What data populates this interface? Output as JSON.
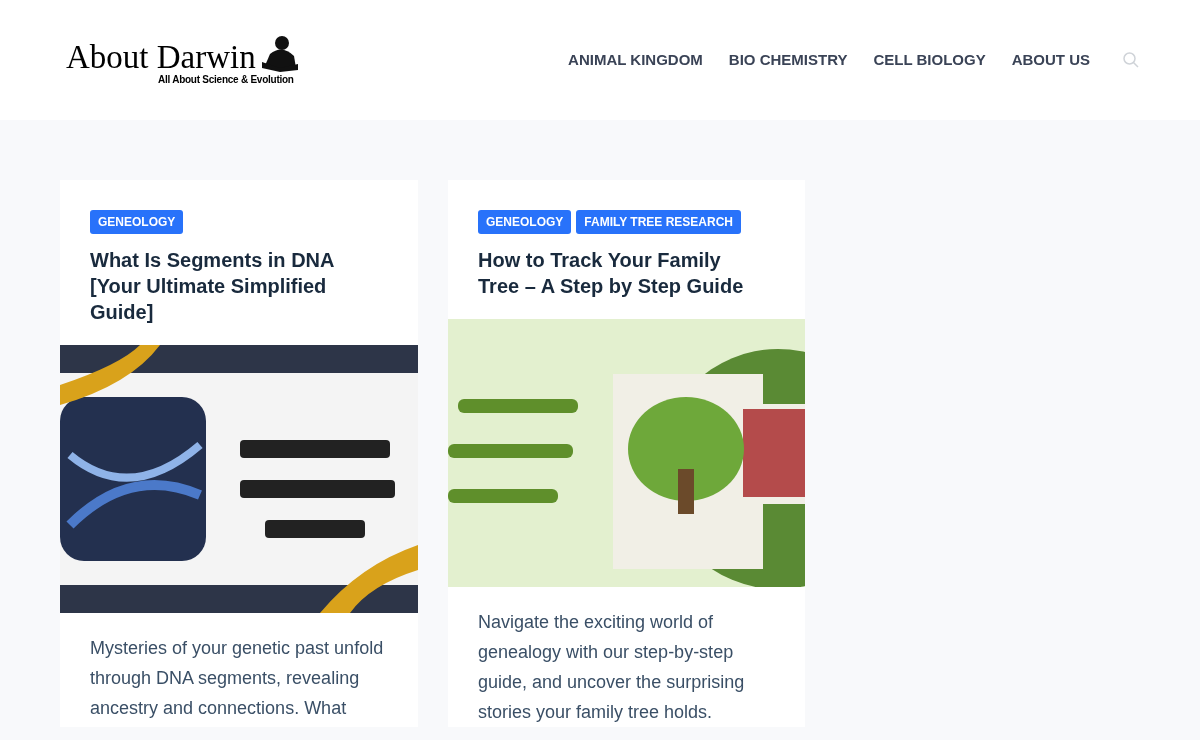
{
  "logo": {
    "name": "About Darwin",
    "tagline": "All About Science & Evolution"
  },
  "nav": [
    {
      "label": "ANIMAL KINGDOM"
    },
    {
      "label": "BIO CHEMISTRY"
    },
    {
      "label": "CELL BIOLOGY"
    },
    {
      "label": "ABOUT US"
    }
  ],
  "posts": [
    {
      "tags": [
        "GENEOLOGY"
      ],
      "title": "What Is Segments in DNA [Your Ultimate Simplified Guide]",
      "image": {
        "kind": "picture"
      },
      "excerpt": "Mysteries of your genetic past unfold through DNA segments, revealing ancestry and connections. What"
    },
    {
      "tags": [
        "GENEOLOGY",
        "FAMILY TREE RESEARCH"
      ],
      "title": "How to Track Your Family Tree – A Step by Step Guide",
      "image": {
        "kind": "picture"
      },
      "excerpt": "Navigate the exciting world of genealogy with our step-by-step guide, and uncover the surprising stories your family tree holds."
    }
  ]
}
